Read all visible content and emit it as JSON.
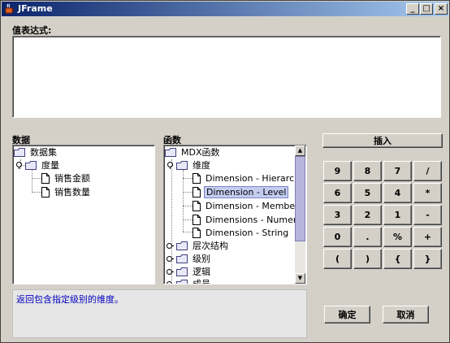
{
  "window": {
    "title": "JFrame",
    "minimize": "_",
    "maximize": "□",
    "close": "×"
  },
  "expression": {
    "label": "值表达式:",
    "value": ""
  },
  "data_panel": {
    "label": "数据",
    "root": "数据集",
    "measure": "度量",
    "items": [
      "销售金额",
      "销售数量"
    ]
  },
  "func_panel": {
    "label": "函数",
    "root": "MDX函数",
    "dimension": "维度",
    "dim_items": [
      "Dimension - Hierarchy",
      "Dimension - Level",
      "Dimension - Member",
      "Dimensions - Numeric",
      "Dimension - String"
    ],
    "selected_item": "Dimension - Level",
    "groups": [
      "层次结构",
      "级别",
      "逻辑",
      "成员"
    ]
  },
  "insert_label": "插入",
  "keypad": [
    [
      "9",
      "8",
      "7",
      "/"
    ],
    [
      "6",
      "5",
      "4",
      "*"
    ],
    [
      "3",
      "2",
      "1",
      "-"
    ],
    [
      "0",
      ".",
      "%",
      "+"
    ],
    [
      "(",
      ")",
      "{",
      "}"
    ]
  ],
  "description": "返回包含指定级别的维度。",
  "ok_label": "确定",
  "cancel_label": "取消",
  "colors": {
    "titlebar_start": "#0a246a",
    "titlebar_end": "#a6caf0",
    "description_text": "#0000c0",
    "selection": "#c4cdf0"
  }
}
